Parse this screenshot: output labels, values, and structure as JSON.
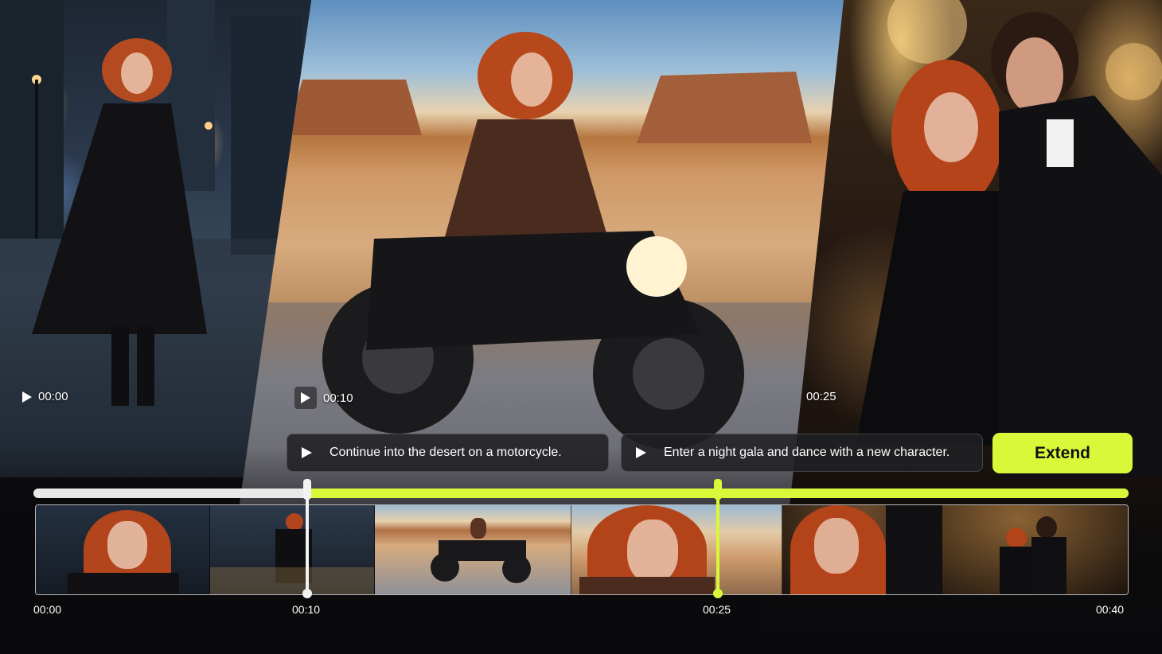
{
  "scenes": [
    {
      "name": "city",
      "timestamp": "00:00"
    },
    {
      "name": "desert",
      "timestamp": "00:10"
    },
    {
      "name": "gala",
      "timestamp": "00:25"
    }
  ],
  "prompts": [
    {
      "text": "Continue into the desert on a motorcycle."
    },
    {
      "text": "Enter a night gala and dance with a new character."
    }
  ],
  "extend_button": {
    "label": "Extend"
  },
  "timeline": {
    "start_label": "00:00",
    "marker_labels": [
      "00:10",
      "00:25"
    ],
    "end_label": "00:40",
    "duration_seconds": 40,
    "played_fraction_start": 0.25,
    "markers_seconds": [
      10,
      25
    ]
  },
  "thumbnails": [
    {
      "scene": "city"
    },
    {
      "scene": "city"
    },
    {
      "scene": "desert"
    },
    {
      "scene": "desert"
    },
    {
      "scene": "gala"
    },
    {
      "scene": "gala"
    }
  ],
  "colors": {
    "accent": "#d9f83a",
    "track": "#e9e9ea",
    "pill_bg": "#202024",
    "text": "#ffffff"
  },
  "icons": {
    "play": "play-icon"
  }
}
